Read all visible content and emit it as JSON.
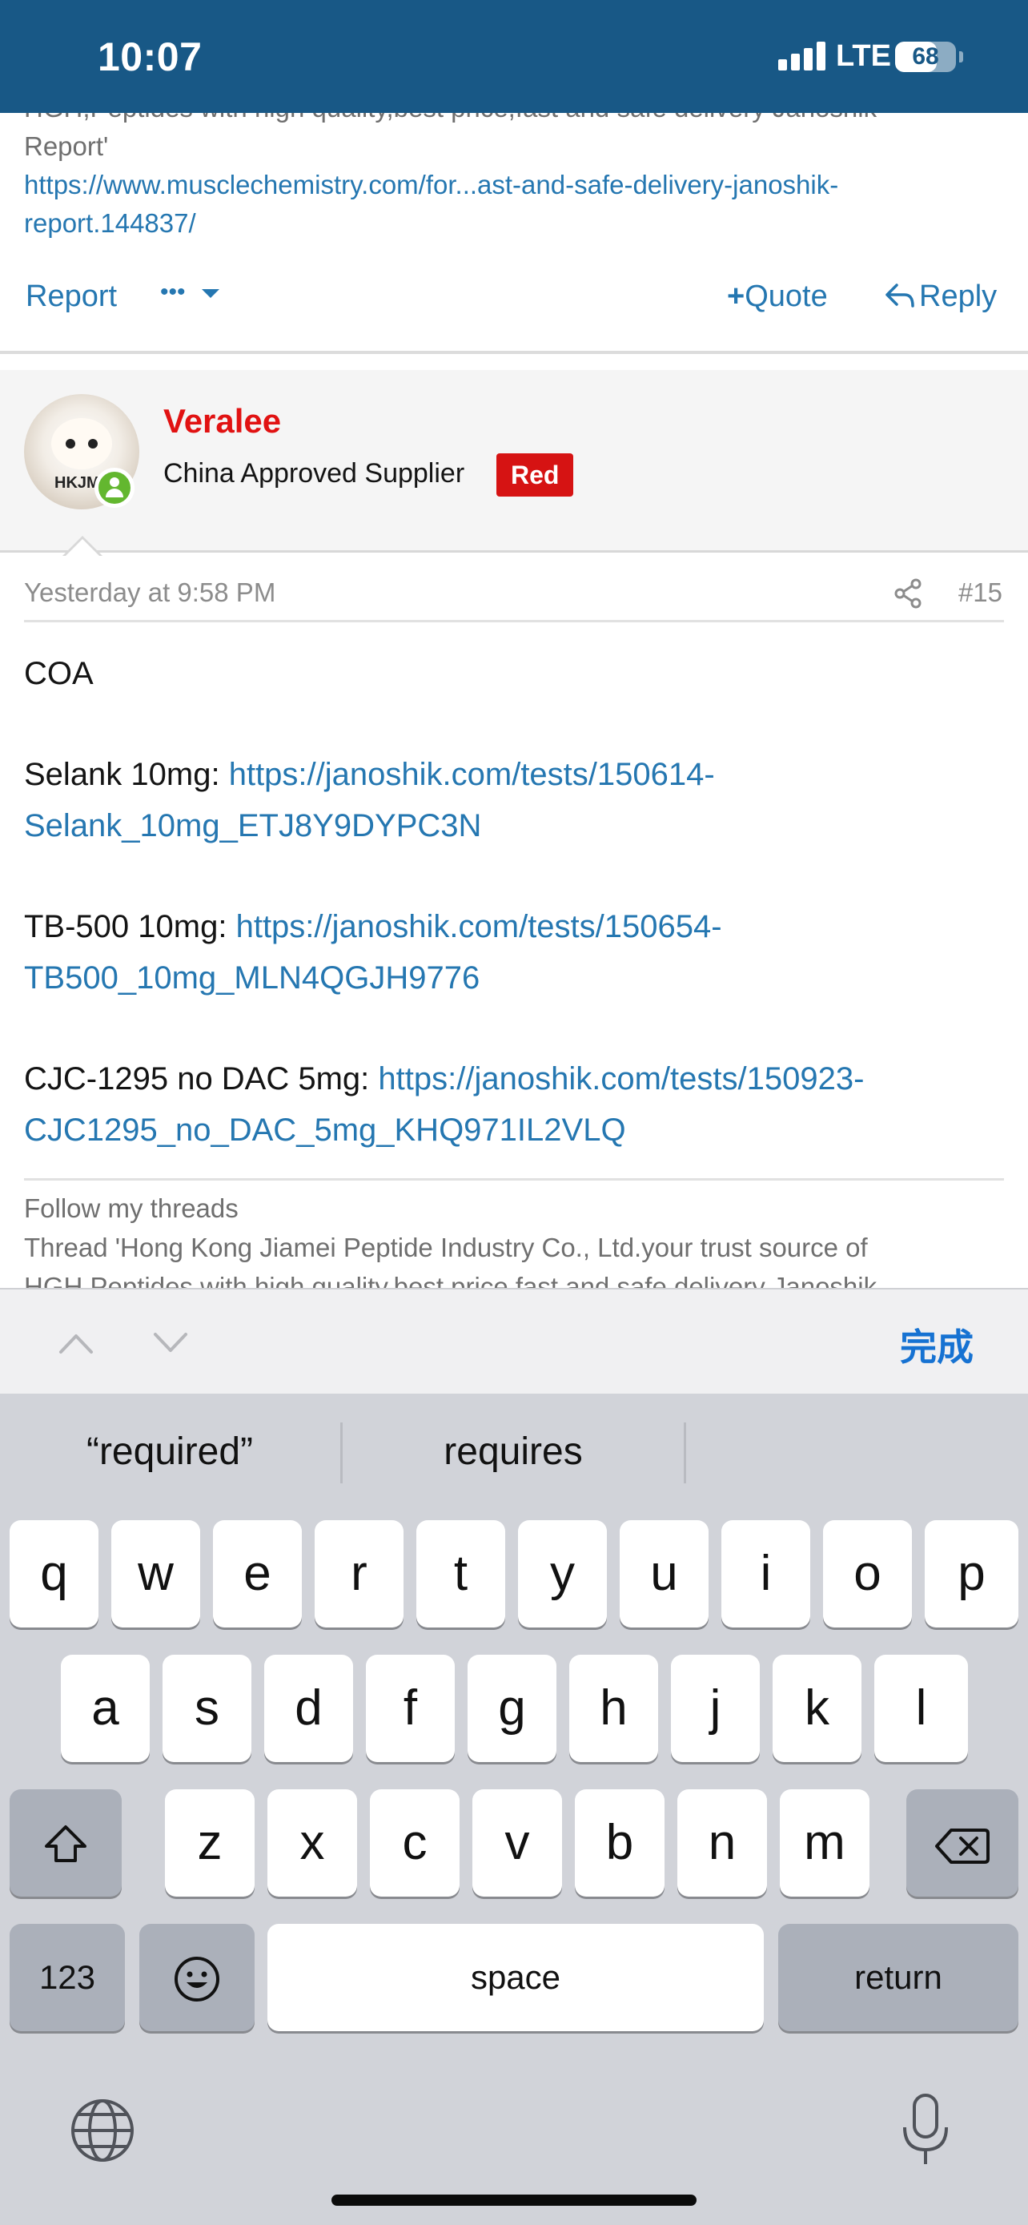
{
  "status_bar": {
    "time": "10:07",
    "network": "LTE",
    "battery_percent": 68,
    "battery_label": "68",
    "signal_icon": "signal-bars-icon"
  },
  "previous_post": {
    "snippet_prefix": "HGH,Peptides with high quality,best price,fast and safe delivery Janoshik",
    "snippet_report": "Report'",
    "link_text": "https://www.musclechemistry.com/for...ast-and-safe-delivery-janoshik-report.144837/",
    "actions": {
      "report": "Report",
      "more": "•••",
      "quote": "Quote",
      "reply": "Reply"
    }
  },
  "post": {
    "username": "Veralee",
    "user_title": "China Approved Supplier",
    "badge": "Red",
    "avatar_text": "HKJM",
    "date": "Yesterday at 9:58 PM",
    "number": "#15",
    "body": {
      "heading": "COA",
      "items": [
        {
          "label": "Selank 10mg: ",
          "link": "https://janoshik.com/tests/150614-Selank_10mg_ETJ8Y9DYPC3N"
        },
        {
          "label": "TB-500 10mg: ",
          "link": "https://janoshik.com/tests/150654-TB500_10mg_MLN4QGJH9776"
        },
        {
          "label": "CJC-1295 no DAC 5mg: ",
          "link": "https://janoshik.com/tests/150923-CJC1295_no_DAC_5mg_KHQ971IL2VLQ"
        }
      ]
    },
    "signature": {
      "title": "Follow my threads",
      "line1": "Thread 'Hong Kong Jiamei Peptide Industry Co., Ltd.your trust source of",
      "line2": "HGH,Peptides with high quality,best price,fast and safe delivery Janoshik"
    }
  },
  "accessory_bar": {
    "done": "完成"
  },
  "keyboard": {
    "suggestions": [
      "“required”",
      "requires",
      ""
    ],
    "row1": [
      "q",
      "w",
      "e",
      "r",
      "t",
      "y",
      "u",
      "i",
      "o",
      "p"
    ],
    "row2": [
      "a",
      "s",
      "d",
      "f",
      "g",
      "h",
      "j",
      "k",
      "l"
    ],
    "row3": [
      "z",
      "x",
      "c",
      "v",
      "b",
      "n",
      "m"
    ],
    "numbers_key": "123",
    "space_key": "space",
    "return_key": "return"
  },
  "colors": {
    "header": "#185886",
    "link": "#2577b1",
    "username": "#e11212",
    "badge": "#d61313",
    "done": "#1672d2"
  }
}
